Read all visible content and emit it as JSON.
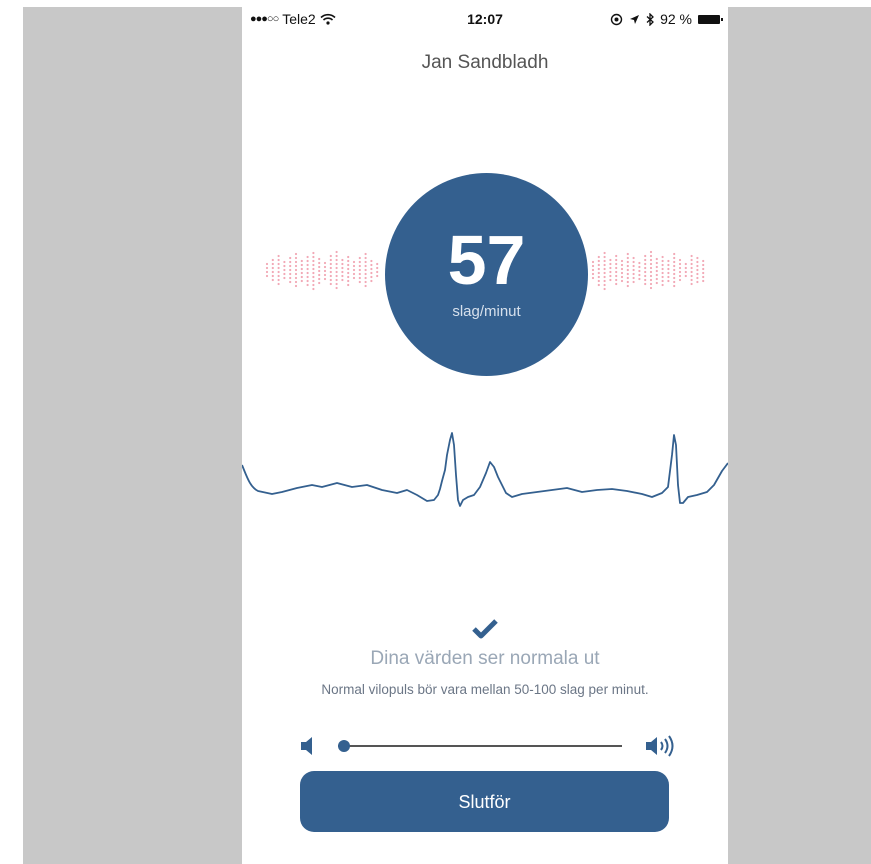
{
  "status_bar": {
    "signal_dots": "●●●○○",
    "carrier": "Tele2",
    "wifi_icon": "wifi-icon",
    "time": "12:07",
    "battery_percent": "92 %",
    "battery_level": 0.92
  },
  "user": {
    "name": "Jan Sandbladh"
  },
  "heart_rate": {
    "value": "57",
    "unit": "slag/minut"
  },
  "result": {
    "title": "Dina värden ser normala ut",
    "description": "Normal vilopuls bör vara mellan 50-100 slag per minut."
  },
  "volume": {
    "level": 0.02
  },
  "actions": {
    "finish_label": "Slutför"
  },
  "colors": {
    "accent": "#34608f",
    "pulse_dots": "#f2a9b6",
    "side_gray": "#c8c8c8"
  }
}
